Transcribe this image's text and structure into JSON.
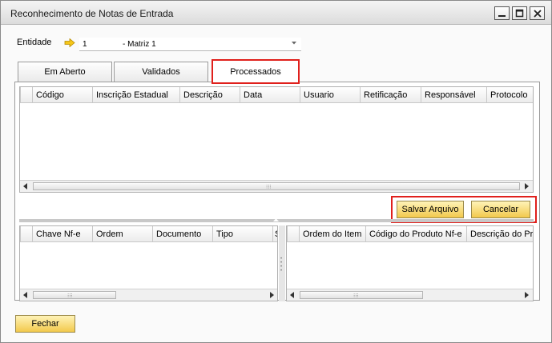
{
  "window": {
    "title": "Reconhecimento de Notas de Entrada"
  },
  "entity": {
    "label": "Entidade",
    "code": "1",
    "name": "- Matriz 1"
  },
  "tabs": [
    {
      "label": "Em Aberto"
    },
    {
      "label": "Validados"
    },
    {
      "label": "Processados"
    }
  ],
  "active_tab": "Processados",
  "top_grid": {
    "columns": [
      "Código",
      "Inscrição Estadual",
      "Descrição",
      "Data",
      "Usuario",
      "Retificação",
      "Responsável",
      "Protocolo"
    ]
  },
  "bottom_left_grid": {
    "columns": [
      "Chave Nf-e",
      "Ordem",
      "Documento",
      "Tipo",
      "S"
    ]
  },
  "bottom_right_grid": {
    "columns": [
      "Ordem do Item",
      "Código do Produto Nf-e",
      "Descrição do Pro"
    ]
  },
  "buttons": {
    "save": "Salvar Arquivo",
    "cancel": "Cancelar",
    "close": "Fechar"
  },
  "colors": {
    "button_fill": "#f2c94c",
    "highlight": "#e0201c"
  }
}
